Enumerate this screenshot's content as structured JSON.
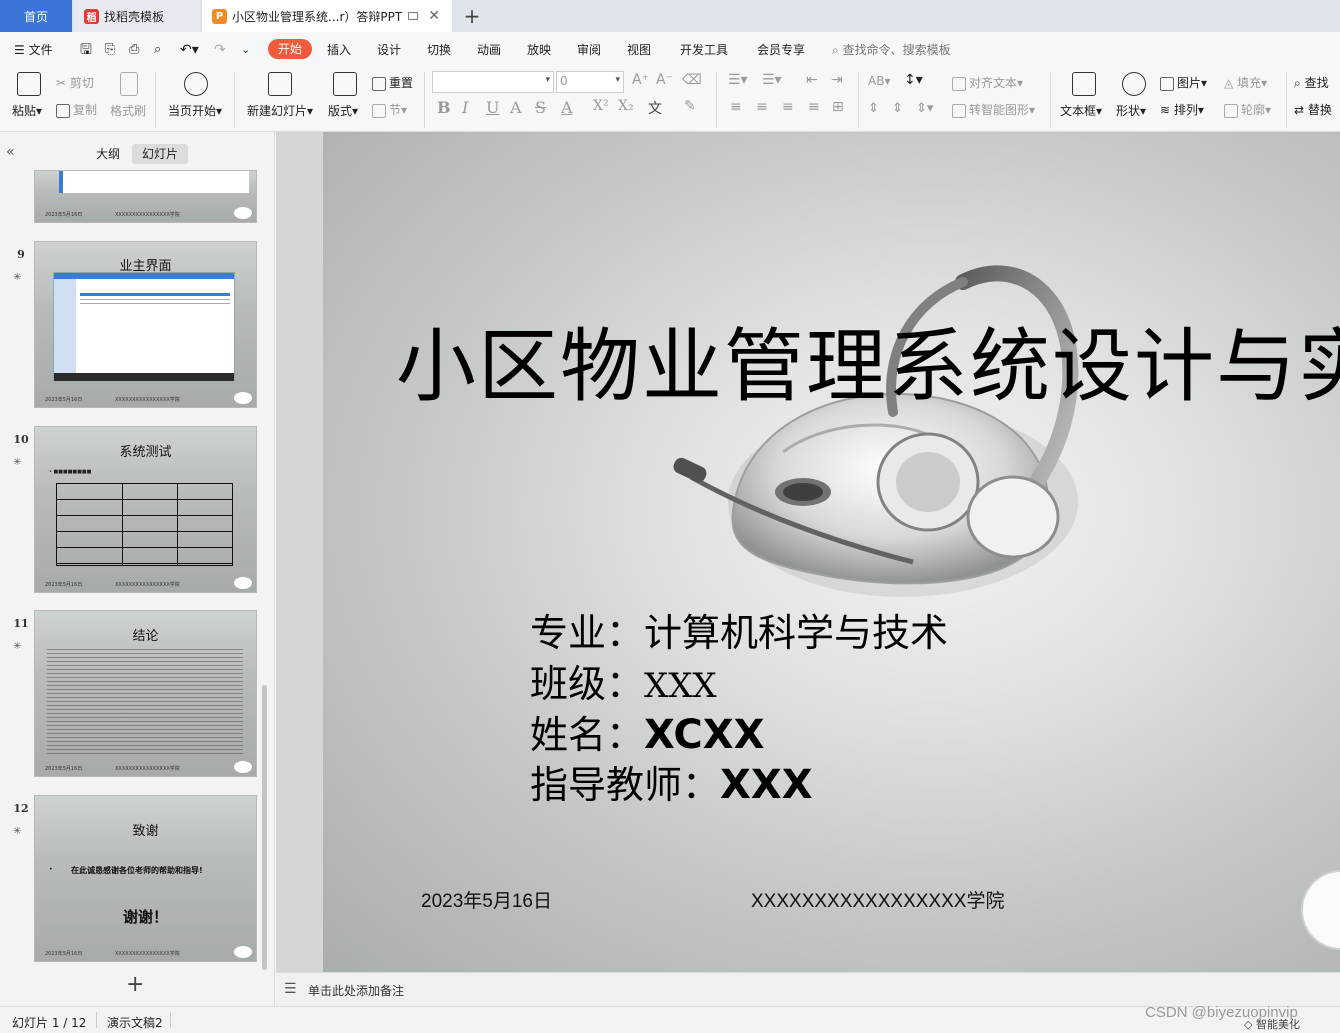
{
  "tabs": {
    "home": "首页",
    "template": "找稻壳模板",
    "document": "小区物业管理系统...r）答辩PPT"
  },
  "menu": {
    "file": "文件",
    "items": [
      "开始",
      "插入",
      "设计",
      "切换",
      "动画",
      "放映",
      "审阅",
      "视图",
      "开发工具",
      "会员专享"
    ],
    "search_placeholder": "查找命令、搜索模板"
  },
  "ribbon": {
    "paste": "粘贴",
    "cut": "剪切",
    "copy": "复制",
    "format_painter": "格式刷",
    "play_from_current": "当页开始",
    "new_slide": "新建幻灯片",
    "layout": "版式",
    "reset": "重置",
    "section": "节",
    "font_size_value": "0",
    "align_text": "对齐文本",
    "smart_shape": "转智能图形",
    "textbox": "文本框",
    "shape": "形状",
    "picture": "图片",
    "arrange": "排列",
    "fill": "填充",
    "outline": "轮廓",
    "find": "查找",
    "replace": "替换"
  },
  "panel": {
    "outline_tab": "大纲",
    "slides_tab": "幻灯片"
  },
  "thumbnails": [
    {
      "num": "9",
      "title": "业主界面"
    },
    {
      "num": "10",
      "title": "系统测试"
    },
    {
      "num": "11",
      "title": "结论"
    },
    {
      "num": "12",
      "title": "致谢",
      "body": "在此诚恳感谢各位老师的帮助和指导!",
      "closing": "谢谢！"
    }
  ],
  "thumb_footer": {
    "date": "2023年5月16日",
    "school": "XXXXXXXXXXXXXXXX学院"
  },
  "slide": {
    "title": "小区物业管理系统设计与实",
    "major_label": "专业：",
    "major_value": "计算机科学与技术",
    "class_label": "班级：",
    "class_value": "XXX",
    "name_label": "姓名：",
    "name_value": "XCXX",
    "advisor_label": "指导教师：",
    "advisor_value": "XXX",
    "date": "2023年5月16日",
    "school": "XXXXXXXXXXXXXXXXX学院"
  },
  "notes_placeholder": "单击此处添加备注",
  "status": {
    "slide_counter": "幻灯片 1 / 12",
    "theme": "演示文稿2",
    "beautify": "智能美化"
  },
  "watermark": "CSDN @biyezuopinvip",
  "colors": {
    "accent": "#ef5b3b",
    "home_tab": "#3c74d8"
  }
}
